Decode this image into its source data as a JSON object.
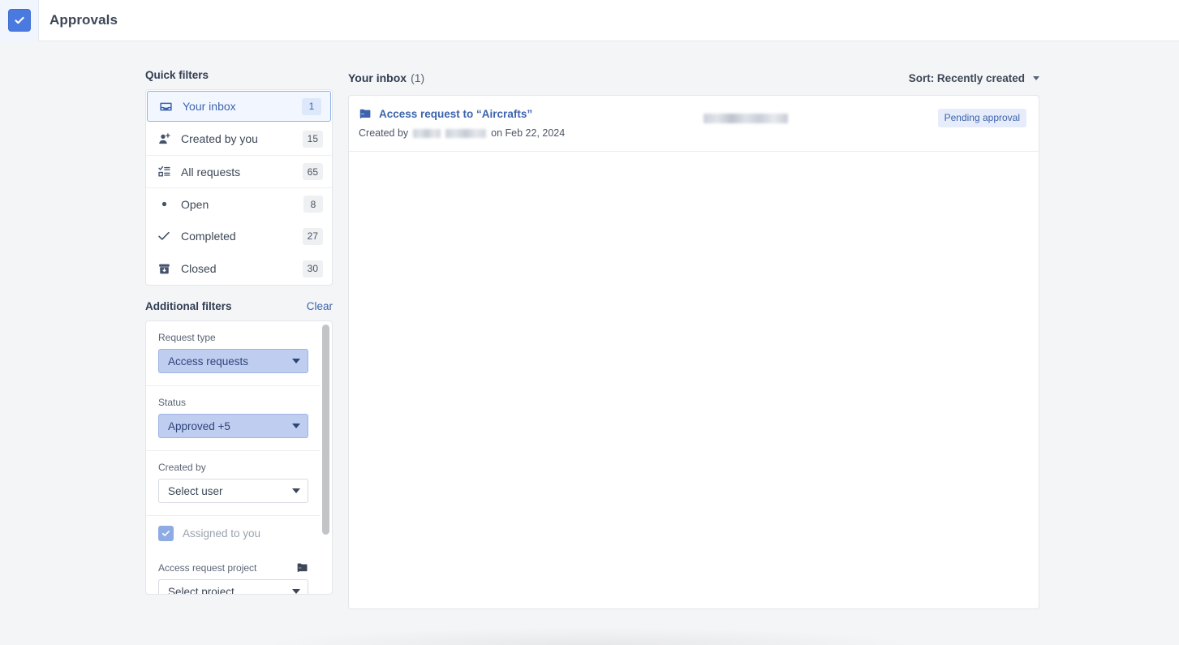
{
  "header": {
    "app_icon": "check-tile-icon",
    "title": "Approvals"
  },
  "sidebar": {
    "quick_filters": {
      "title": "Quick filters",
      "items": [
        {
          "icon": "inbox-icon",
          "label": "Your inbox",
          "count": "1",
          "active": true
        },
        {
          "icon": "user-add-icon",
          "label": "Created by you",
          "count": "15",
          "active": false
        },
        {
          "icon": "checklist-icon",
          "label": "All requests",
          "count": "65",
          "active": false
        },
        {
          "icon": "dot-icon",
          "label": "Open",
          "count": "8",
          "active": false
        },
        {
          "icon": "check-icon",
          "label": "Completed",
          "count": "27",
          "active": false
        },
        {
          "icon": "archive-icon",
          "label": "Closed",
          "count": "30",
          "active": false
        }
      ]
    },
    "additional_filters": {
      "title": "Additional filters",
      "clear_label": "Clear",
      "request_type": {
        "label": "Request type",
        "value": "Access requests"
      },
      "status": {
        "label": "Status",
        "value": "Approved +5"
      },
      "created_by": {
        "label": "Created by",
        "value": "Select user"
      },
      "assigned_to_you": {
        "label": "Assigned to you",
        "checked": true
      },
      "access_request_project": {
        "label": "Access request project",
        "icon": "shared-folder-icon",
        "value": "Select project"
      }
    }
  },
  "main": {
    "inbox_title": "Your inbox",
    "inbox_count": "(1)",
    "sort_label": "Sort: Recently created",
    "rows": [
      {
        "icon": "shared-folder-icon",
        "title": "Access request to “Aircrafts”",
        "created_prefix": "Created by",
        "created_by": "",
        "created_suffix": "on Feb 22, 2024",
        "assignee": "",
        "status": "Pending approval"
      }
    ]
  },
  "colors": {
    "accent": "#3c63ad",
    "app_tile": "#4a7ae0",
    "badge_bg": "#e6ecfa",
    "filled_select": "#bfcef0",
    "page_bg": "#f4f5f7"
  }
}
